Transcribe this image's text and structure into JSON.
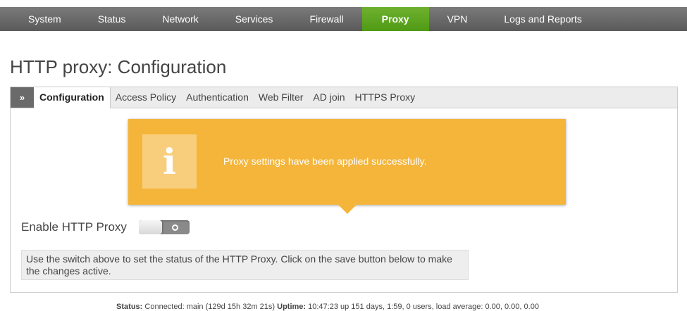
{
  "nav": {
    "items": [
      {
        "label": "System",
        "active": false
      },
      {
        "label": "Status",
        "active": false
      },
      {
        "label": "Network",
        "active": false
      },
      {
        "label": "Services",
        "active": false
      },
      {
        "label": "Firewall",
        "active": false
      },
      {
        "label": "Proxy",
        "active": true
      },
      {
        "label": "VPN",
        "active": false
      },
      {
        "label": "Logs and Reports",
        "active": false
      }
    ]
  },
  "page": {
    "title": "HTTP proxy: Configuration"
  },
  "tabs": {
    "chevron": "»",
    "items": [
      "Configuration",
      "Access Policy",
      "Authentication",
      "Web Filter",
      "AD join",
      "HTTPS Proxy"
    ],
    "active_index": 0
  },
  "notice": {
    "icon": "info-icon",
    "icon_glyph": "i",
    "message": "Proxy settings have been applied successfully."
  },
  "form": {
    "enable_label": "Enable HTTP Proxy",
    "enabled": false,
    "help_text": "Use the switch above to set the status of the HTTP Proxy. Click on the save button below to make the changes active."
  },
  "status_bar": {
    "status_label": "Status:",
    "status_value": "Connected: main (129d 15h 32m 21s)",
    "uptime_label": "Uptime:",
    "uptime_value": "10:47:23 up 151 days, 1:59, 0 users, load average: 0.00, 0.00, 0.00"
  },
  "colors": {
    "nav_bg": "#666666",
    "nav_active": "#5aa51e",
    "notice_bg": "#f4b53a",
    "text": "#444444"
  }
}
